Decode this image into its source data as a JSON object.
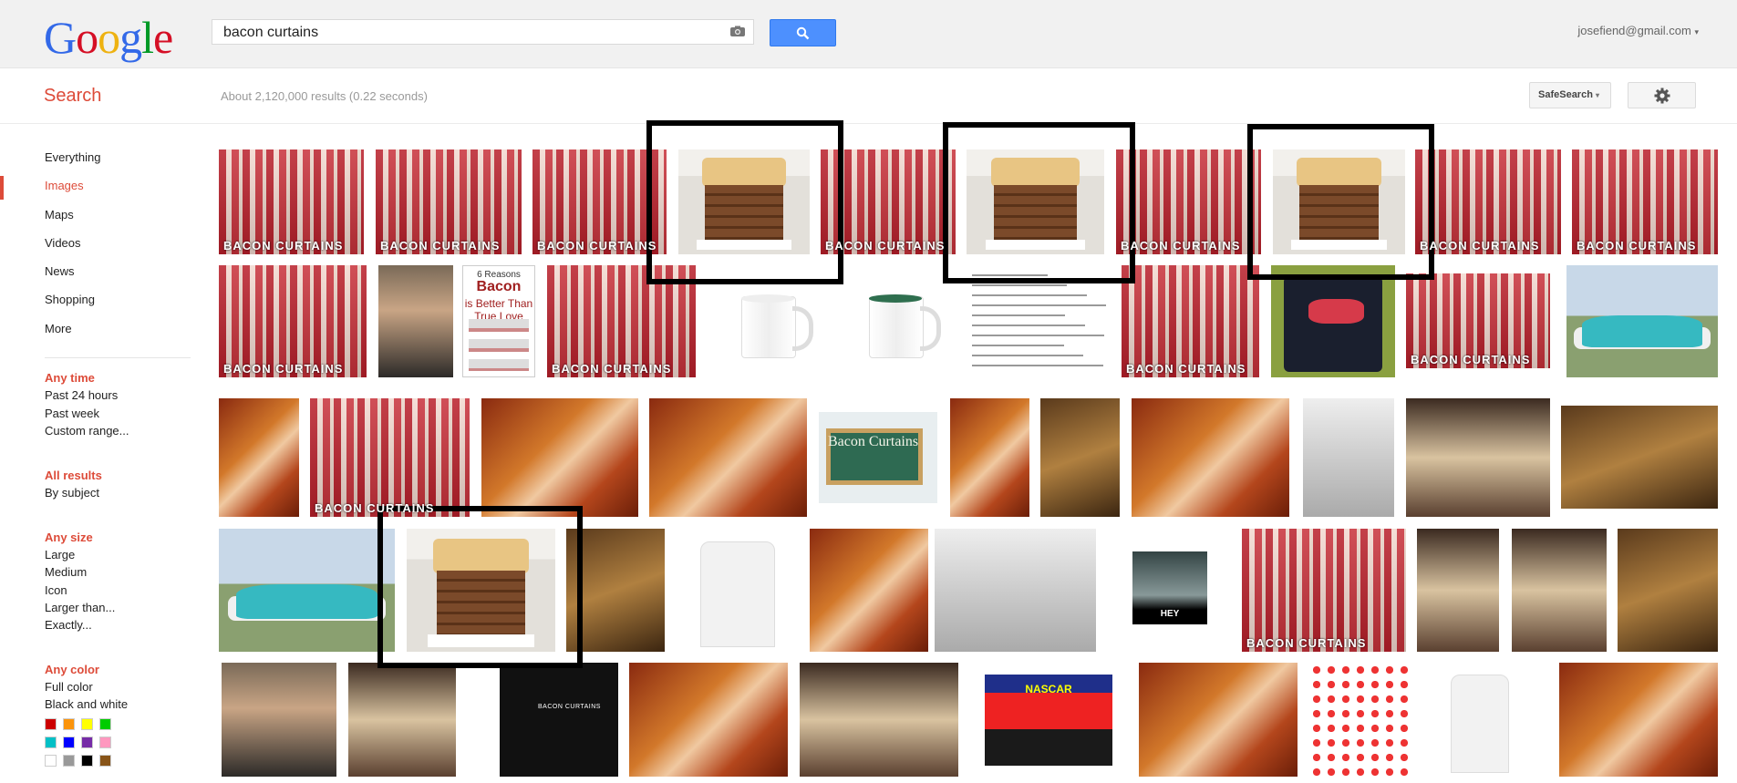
{
  "header": {
    "logo_letters": [
      {
        "ch": "G",
        "color": "#3369e8"
      },
      {
        "ch": "o",
        "color": "#d50f25"
      },
      {
        "ch": "o",
        "color": "#eeb211"
      },
      {
        "ch": "g",
        "color": "#3369e8"
      },
      {
        "ch": "l",
        "color": "#009925"
      },
      {
        "ch": "e",
        "color": "#d50f25"
      }
    ],
    "search_query": "bacon curtains",
    "camera_icon": "camera-icon",
    "search_button_icon": "magnifier-icon",
    "account_email": "josefiend@gmail.com",
    "account_caret": "▾"
  },
  "subbar": {
    "title": "Search",
    "result_stats": "About 2,120,000 results (0.22 seconds)",
    "safesearch_label": "SafeSearch",
    "safesearch_caret": "▾",
    "settings_icon": "gear-icon"
  },
  "nav": {
    "items": [
      "Everything",
      "Images",
      "Maps",
      "Videos",
      "News",
      "Shopping",
      "More"
    ],
    "active": "Images"
  },
  "tools": {
    "time": {
      "head": "Any time",
      "items": [
        "Past 24 hours",
        "Past week",
        "Custom range..."
      ]
    },
    "results": {
      "head": "All results",
      "items": [
        "By subject"
      ]
    },
    "size": {
      "head": "Any size",
      "items": [
        "Large",
        "Medium",
        "Icon",
        "Larger than...",
        "Exactly..."
      ]
    },
    "color": {
      "head": "Any color",
      "items": [
        "Full color",
        "Black and white"
      ],
      "swatches": [
        "#cc0000",
        "#fb940b",
        "#ffff00",
        "#00cc00",
        "#03c0c6",
        "#0000ff",
        "#762ca7",
        "#ff98bf",
        "#ffffff",
        "#999999",
        "#000000",
        "#885418"
      ]
    }
  },
  "images": {
    "curtain_label": "BACON CURTAINS",
    "blackboard_text": "Bacon Curtains",
    "book_lines": [
      "6 Reasons",
      "Bacon",
      "is Better Than True Love"
    ],
    "tee_text": "BACON CURTAINS",
    "hey_text": "HEY",
    "nascar_text": "NASCAR"
  }
}
